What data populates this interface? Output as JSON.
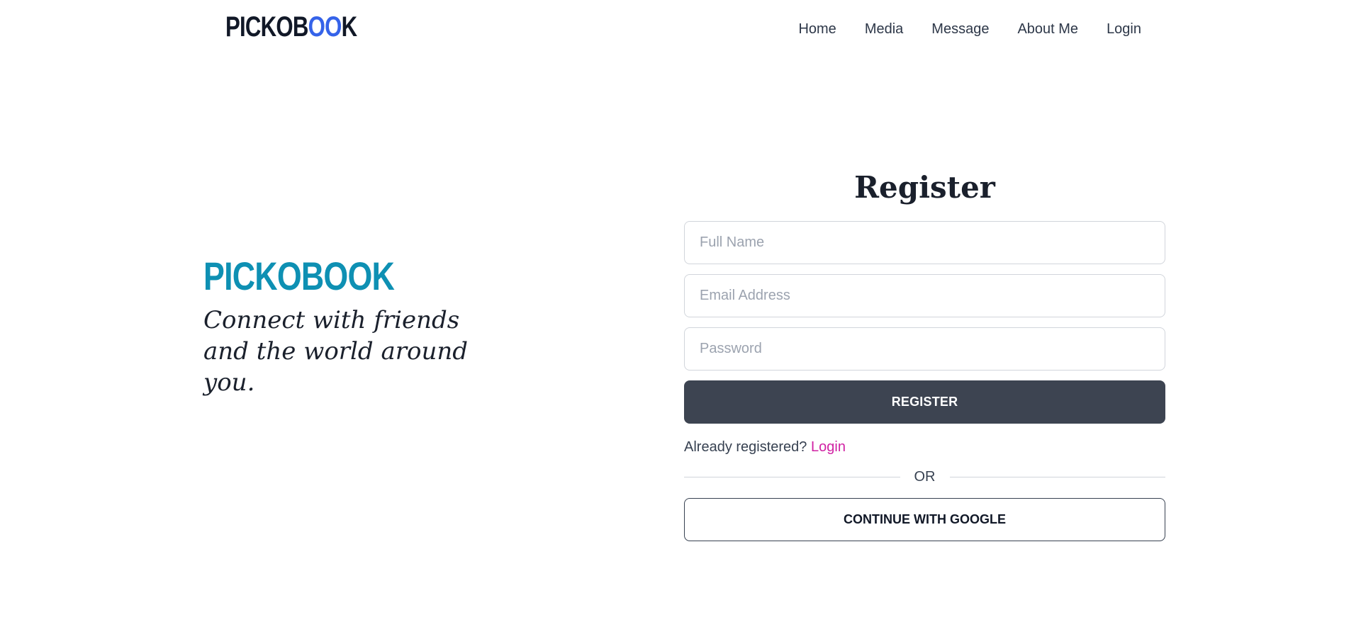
{
  "header": {
    "logo_main": "PICKOB",
    "logo_accent": "OO",
    "logo_end": "K",
    "nav": [
      "Home",
      "Media",
      "Message",
      "About Me",
      "Login"
    ]
  },
  "hero": {
    "title": "PICKOBOOK",
    "tagline": "Connect with friends and the world around you."
  },
  "form": {
    "title": "Register",
    "full_name_placeholder": "Full Name",
    "email_placeholder": "Email Address",
    "password_placeholder": "Password",
    "register_label": "REGISTER",
    "already_text": "Already registered?",
    "login_link": "Login",
    "or_text": "OR",
    "google_label": "CONTINUE WITH GOOGLE"
  },
  "colors": {
    "brand_accent": "#3563e9",
    "hero_title": "#0e90b3",
    "register_button": "#3d4451",
    "login_link": "#d021a3"
  }
}
